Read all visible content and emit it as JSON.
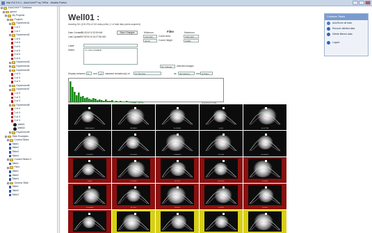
{
  "window": {
    "title": "http://12.0.0.1 - AutoCelmi™ by TriPar - Mozilla Firefox"
  },
  "tree": {
    "db_label": "AutoCelmi™ Database",
    "root": "gene4",
    "my_projects": "My Projects",
    "project": "Project1",
    "nodes": [
      {
        "t": "Experiment1",
        "k": "folder",
        "d": 4
      },
      {
        "t": "1 of 2",
        "k": "red",
        "d": 5
      },
      {
        "t": "2 of 2",
        "k": "red",
        "d": 5
      },
      {
        "t": "Experiment2",
        "k": "folder",
        "d": 4
      },
      {
        "t": "1 of 6",
        "k": "red",
        "d": 5
      },
      {
        "t": "2 of 6",
        "k": "red",
        "d": 5
      },
      {
        "t": "3 of 6",
        "k": "red",
        "d": 5
      },
      {
        "t": "4 of 6",
        "k": "red",
        "d": 5
      },
      {
        "t": "5 of 6",
        "k": "red",
        "d": 5
      },
      {
        "t": "6 of 6",
        "k": "red",
        "d": 5
      },
      {
        "t": "Experiment3",
        "k": "folder",
        "d": 4
      },
      {
        "t": "Experiment4",
        "k": "folder",
        "d": 4
      },
      {
        "t": "Experiment5",
        "k": "folder",
        "d": 4
      },
      {
        "t": "1 of 3",
        "k": "red",
        "d": 5
      },
      {
        "t": "2 of 3",
        "k": "red",
        "d": 5
      },
      {
        "t": "3 of 3",
        "k": "red",
        "d": 5
      },
      {
        "t": "Experiment6",
        "k": "folder",
        "d": 4
      },
      {
        "t": "Experiment7",
        "k": "folder",
        "d": 4
      },
      {
        "t": "1 of 3",
        "k": "red",
        "d": 5
      },
      {
        "t": "2 of 3",
        "k": "red",
        "d": 5
      },
      {
        "t": "3 of 3",
        "k": "red",
        "d": 5
      },
      {
        "t": "Experiment8",
        "k": "folder",
        "d": 4
      },
      {
        "t": "1 of 4",
        "k": "red",
        "d": 5
      },
      {
        "t": "2 of 4",
        "k": "red",
        "d": 5
      },
      {
        "t": "3 of 4",
        "k": "red",
        "d": 5
      },
      {
        "t": "4 of 4",
        "k": "red",
        "d": 5
      },
      {
        "t": "Well01",
        "k": "well",
        "d": 6
      },
      {
        "t": "Well02",
        "k": "well",
        "d": 6
      },
      {
        "t": "Experiment9",
        "k": "folder",
        "d": 4
      },
      {
        "t": "Slide Examples",
        "k": "folder",
        "d": 2
      },
      {
        "t": "Control Slides",
        "k": "folder",
        "d": 3
      },
      {
        "t": "Slide1",
        "k": "blue",
        "d": 4
      },
      {
        "t": "Slide2",
        "k": "blue",
        "d": 4
      },
      {
        "t": "Slide3",
        "k": "blue",
        "d": 4
      },
      {
        "t": "Slide4",
        "k": "blue",
        "d": 4
      },
      {
        "t": "Control Slides H",
        "k": "folder",
        "d": 3
      },
      {
        "t": "Slide1",
        "k": "blue",
        "d": 4
      },
      {
        "t": "Fibro",
        "k": "folder",
        "d": 3
      },
      {
        "t": "Slide1",
        "k": "blue",
        "d": 4
      },
      {
        "t": "Slide2",
        "k": "blue",
        "d": 4
      },
      {
        "t": "Slide3",
        "k": "blue",
        "d": 4
      },
      {
        "t": "Generic Slide",
        "k": "folder",
        "d": 3
      },
      {
        "t": "Slide1",
        "k": "blue",
        "d": 4
      },
      {
        "t": "Slide2",
        "k": "blue",
        "d": 4
      },
      {
        "t": "Slide3",
        "k": "blue",
        "d": 4
      }
    ]
  },
  "header": {
    "title": "Well01 :",
    "subtitle": "showing 341 (100.0%) of 341 data points ( 1 of total data points acquired)"
  },
  "info": {
    "date_created_label": "Date Created:",
    "date_created": "7/1/2010 5:32:59 AM",
    "last_update_label": "Last Update:",
    "last_update": "5/7/2010 8:16:27:56 AM",
    "save_changes": "Save Changes",
    "label_label": "Label:",
    "notes_label": "Notes:",
    "notes_value": "no notes available"
  },
  "filter": {
    "min_label": "Minimum",
    "filter_label": "Filter",
    "max_label": "Maximum",
    "row1_min": "0.00 400",
    "row1_name": "Cored Area",
    "row1_max": "7000 400",
    "row2_min": "40.00",
    "row2_name": "Cored Height",
    "row2_max": "10000"
  },
  "selection": {
    "no_change": "No Change",
    "selected_images": "selected images"
  },
  "display": {
    "display_between": "Display between",
    "v1": "0",
    "and": "and",
    "v2": "+0",
    "std_of": "standard deviation(s) of",
    "metric": "Tot Monster",
    "as": "as",
    "order": "decreasing",
    "and2": "and",
    "mode": "profiled"
  },
  "hist_labels": {
    "left": "Area (monsters)",
    "mid": "+ 11.500  -+ 31.00",
    "right": "largest/total vanilla"
  },
  "histogram": [
    30,
    22,
    15,
    10,
    14,
    8,
    9,
    6,
    7,
    5,
    4,
    6,
    5,
    3,
    4,
    3,
    2,
    4,
    2,
    2,
    3,
    1,
    2,
    1,
    2,
    1,
    1,
    2,
    1,
    1,
    1,
    1,
    1,
    1,
    1
  ],
  "cells": [
    {
      "id": "99999-Well01",
      "bg": "black"
    },
    {
      "id": "98-38469",
      "bg": "black"
    },
    {
      "id": "94-188981",
      "bg": "black"
    },
    {
      "id": "3-4001",
      "bg": "black"
    },
    {
      "id": "43-137798",
      "bg": "black"
    },
    {
      "id": "91-50484",
      "bg": "black"
    },
    {
      "id": "102-28041",
      "bg": "black"
    },
    {
      "id": "7-9080000",
      "bg": "black"
    },
    {
      "id": "85-1308",
      "bg": "black"
    },
    {
      "id": "80-180062",
      "bg": "black"
    },
    {
      "id": "1-6000",
      "bg": "red"
    },
    {
      "id": "Y4-18081",
      "bg": "red"
    },
    {
      "id": "46-7101",
      "bg": "red"
    },
    {
      "id": "48-12041",
      "bg": "red"
    },
    {
      "id": "32-18081",
      "bg": "red"
    },
    {
      "id": "37-100000",
      "bg": "red"
    },
    {
      "id": "81-2101",
      "bg": "red"
    },
    {
      "id": "28-4101",
      "bg": "red"
    },
    {
      "id": "6-12091",
      "bg": "red"
    },
    {
      "id": "50-3021",
      "bg": "red"
    },
    {
      "id": "16-4101",
      "bg": "red"
    },
    {
      "id": "14-24011",
      "bg": "yellow"
    },
    {
      "id": "19-81041",
      "bg": "yellow"
    },
    {
      "id": "20-12080",
      "bg": "yellow"
    },
    {
      "id": "44-100",
      "bg": "yellow"
    }
  ],
  "right_panel": {
    "title": "Common Tasks",
    "items": [
      "AutoScore all data",
      "Recover deleted data",
      "Delete filtered data",
      "Logout"
    ],
    "icon_colors": [
      "#3f7bd0",
      "#2d62b8",
      "#2d62b8",
      "#2d62b8"
    ]
  },
  "colors": {
    "red_cell": "#8b1010",
    "yellow_cell": "#d8cf16",
    "hist_green": "#1c8a1c",
    "accent": "#7b9bd0"
  }
}
